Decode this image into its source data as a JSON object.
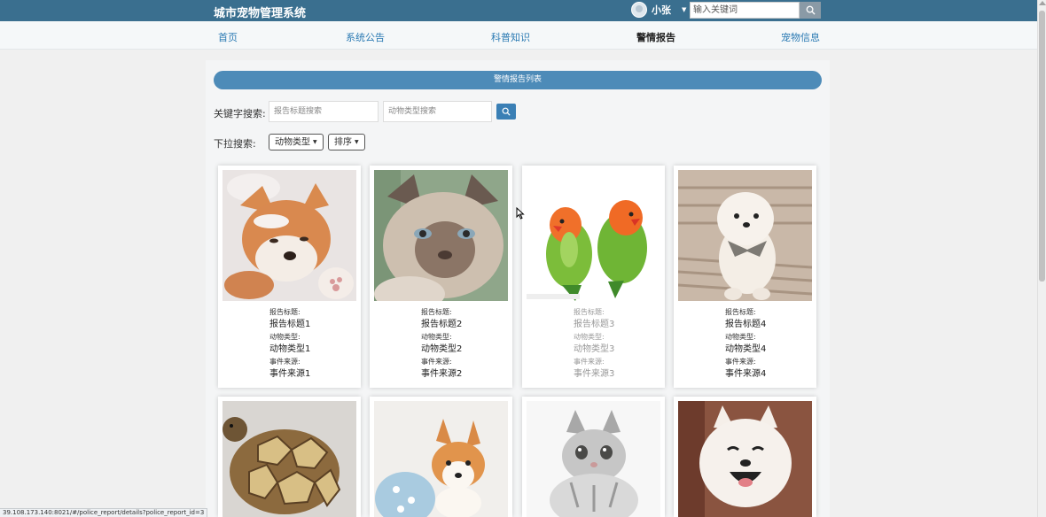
{
  "app": {
    "title": "城市宠物管理系统"
  },
  "user": {
    "name": "小张"
  },
  "search": {
    "placeholder": "输入关键词"
  },
  "nav": {
    "items": [
      {
        "label": "首页"
      },
      {
        "label": "系统公告"
      },
      {
        "label": "科普知识"
      },
      {
        "label": "警情报告"
      },
      {
        "label": "宠物信息"
      }
    ],
    "active": "警情报告"
  },
  "list": {
    "title": "警情报告列表"
  },
  "filters": {
    "keyword_label": "关键字搜索:",
    "title_placeholder": "报告标题搜索",
    "type_placeholder": "动物类型搜索",
    "dropdown_label": "下拉搜索:",
    "type_dropdown": "动物类型",
    "sort_dropdown": "排序"
  },
  "field_labels": {
    "title": "报告标题:",
    "type": "动物类型:",
    "source": "事件来源:"
  },
  "cards": [
    {
      "title": "报告标题1",
      "type": "动物类型1",
      "source": "事件来源1",
      "image": "shiba-dog-photo"
    },
    {
      "title": "报告标题2",
      "type": "动物类型2",
      "source": "事件来源2",
      "image": "siamese-cat-photo"
    },
    {
      "title": "报告标题3",
      "type": "动物类型3",
      "source": "事件来源3",
      "image": "lovebird-parrots-photo"
    },
    {
      "title": "报告标题4",
      "type": "动物类型4",
      "source": "事件来源4",
      "image": "pomeranian-dog-photo"
    },
    {
      "image": "tortoise-photo"
    },
    {
      "image": "corgi-puppy-photo"
    },
    {
      "image": "kitten-photo"
    },
    {
      "image": "samoyed-dog-photo"
    }
  ],
  "status_url": "39.108.173.140:8021/#/police_report/details?police_report_id=3",
  "colors": {
    "topbar": "#3a6f8f",
    "accent": "#4d8bb8",
    "link": "#2b7ab3"
  }
}
